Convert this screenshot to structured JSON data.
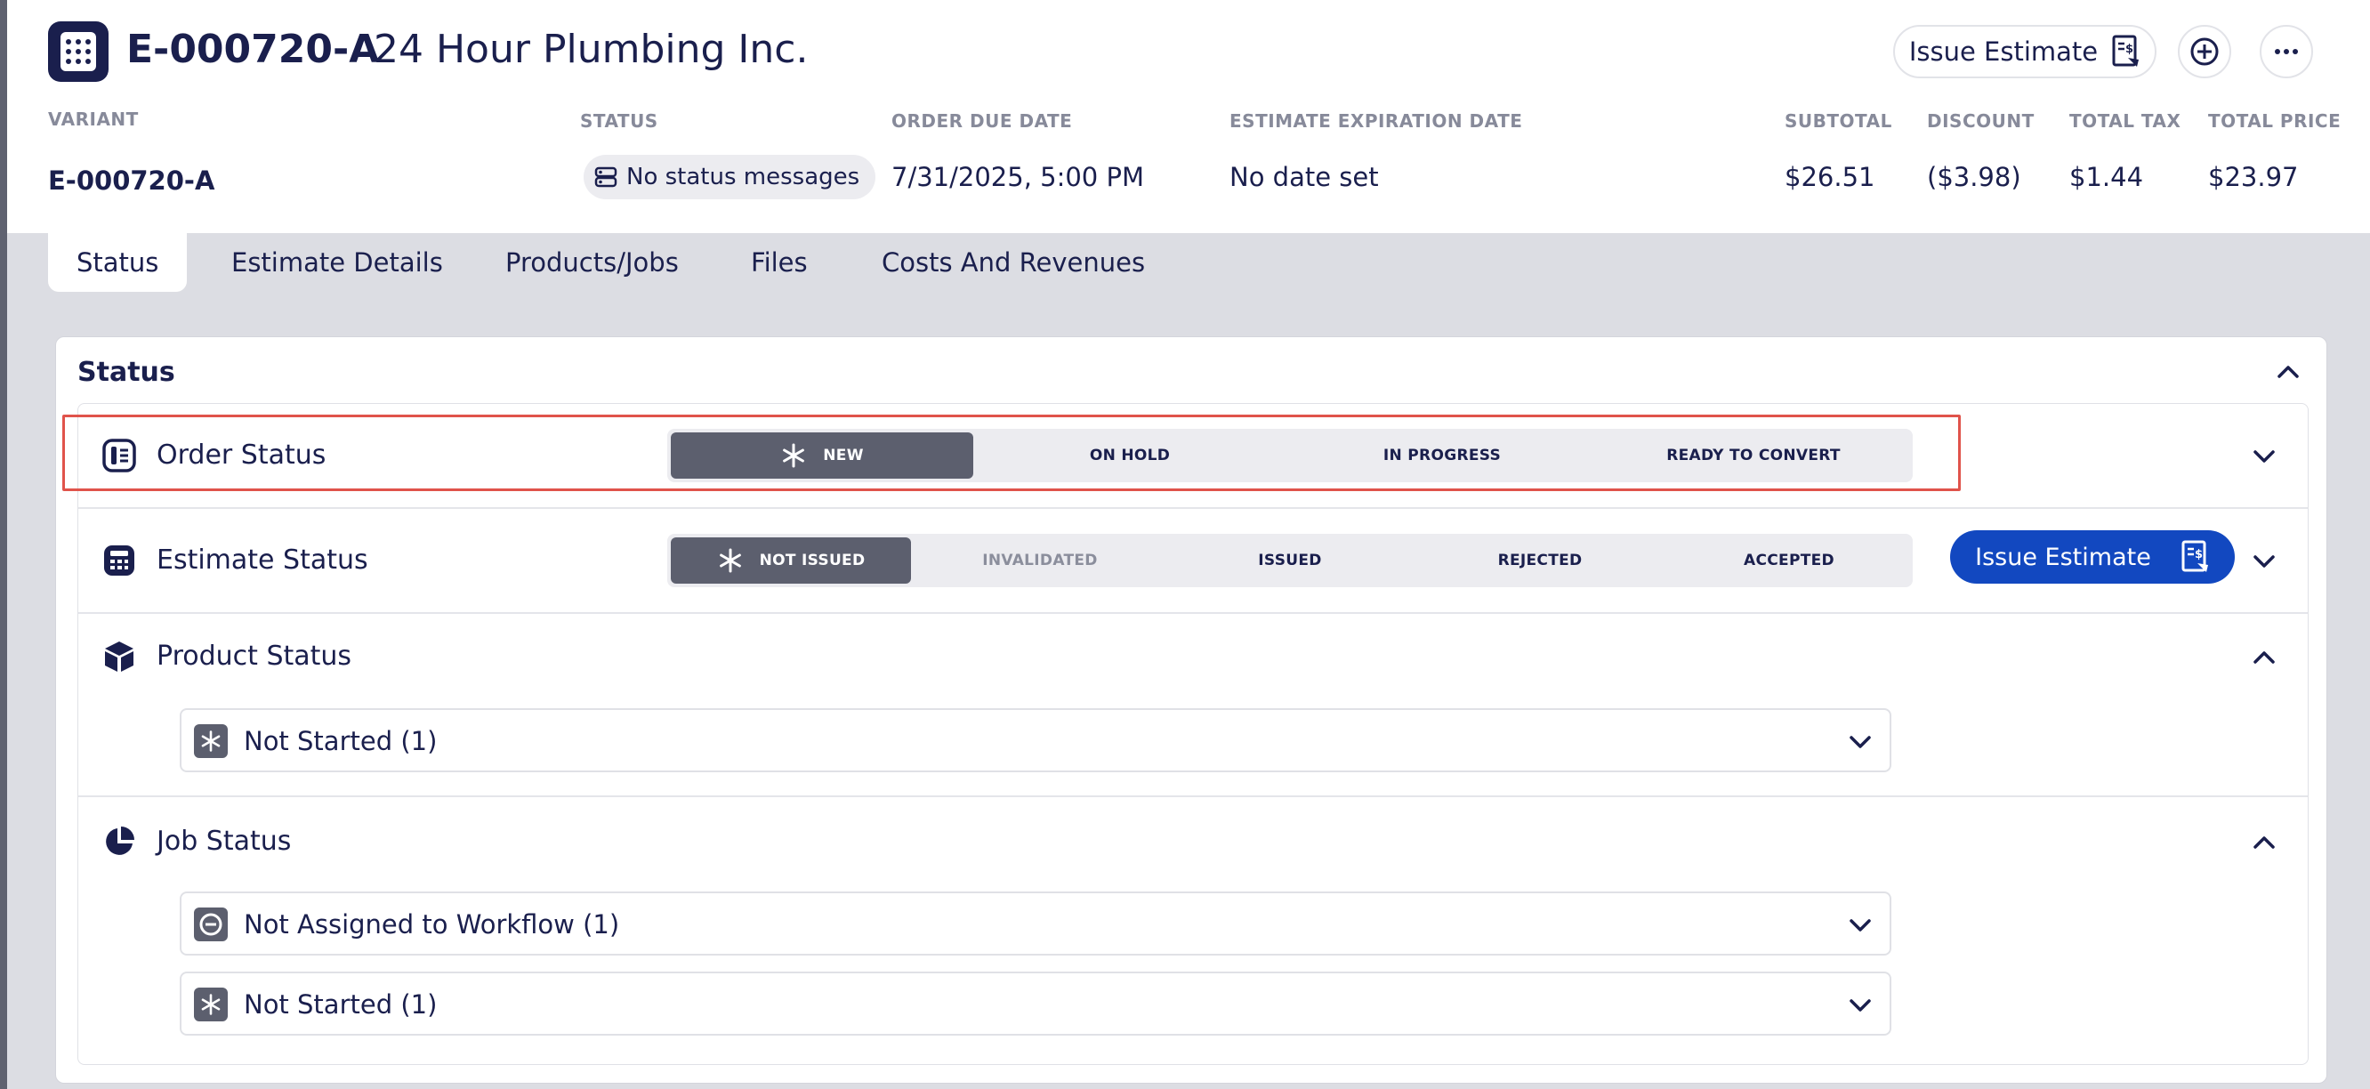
{
  "header": {
    "order_id": "E-000720-A",
    "company": "24 Hour Plumbing Inc.",
    "issue_estimate_label": "Issue Estimate"
  },
  "meta": {
    "variant_label": "VARIANT",
    "variant_value": "E-000720-A",
    "status_label": "STATUS",
    "status_value": "No status messages",
    "due_label": "ORDER DUE DATE",
    "due_value": "7/31/2025, 5:00 PM",
    "expiration_label": "ESTIMATE EXPIRATION DATE",
    "expiration_value": "No date set",
    "subtotal_label": "SUBTOTAL",
    "subtotal_value": "$26.51",
    "discount_label": "DISCOUNT",
    "discount_value": "($3.98)",
    "tax_label": "TOTAL TAX",
    "tax_value": "$1.44",
    "price_label": "TOTAL PRICE",
    "price_value": "$23.97"
  },
  "tabs": [
    {
      "label": "Status"
    },
    {
      "label": "Estimate Details"
    },
    {
      "label": "Products/Jobs"
    },
    {
      "label": "Files"
    },
    {
      "label": "Costs And Revenues"
    }
  ],
  "card": {
    "title": "Status",
    "order_status": {
      "title": "Order Status",
      "options": [
        "NEW",
        "ON HOLD",
        "IN PROGRESS",
        "READY TO CONVERT"
      ],
      "selected": "NEW"
    },
    "estimate_status": {
      "title": "Estimate Status",
      "options": [
        "NOT ISSUED",
        "INVALIDATED",
        "ISSUED",
        "REJECTED",
        "ACCEPTED"
      ],
      "selected": "NOT ISSUED",
      "button_label": "Issue Estimate"
    },
    "product_status": {
      "title": "Product Status",
      "rows": [
        "Not Started (1)"
      ]
    },
    "job_status": {
      "title": "Job Status",
      "rows": [
        "Not Assigned to Workflow (1)",
        "Not Started (1)"
      ]
    }
  },
  "icons": {
    "app": "calculator-icon",
    "issue": "invoice-icon",
    "add_circle": "plus-circle-icon",
    "more": "ellipsis-icon",
    "order_status": "columns-icon",
    "estimate_status": "calculator-icon",
    "product_status": "cube-icon",
    "job_status": "pie-chart-icon",
    "new": "asterisk-icon",
    "not_assigned": "minus-circle-icon"
  },
  "colors": {
    "navy": "#1a1f4d",
    "primary_blue": "#1248c0",
    "active_segment": "#5c5f6e",
    "highlight_red": "#e0534b"
  }
}
